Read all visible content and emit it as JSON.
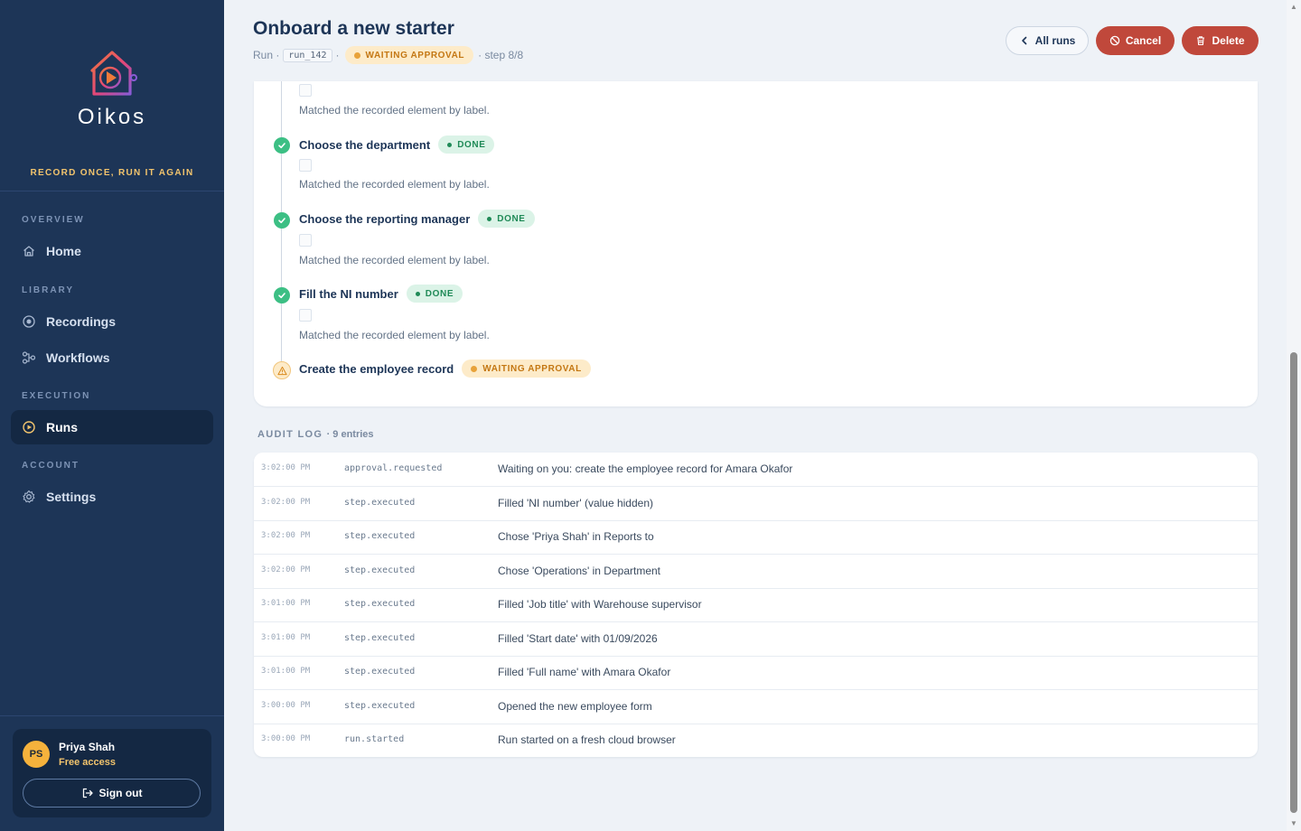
{
  "app": {
    "brand_name": "Oikos",
    "tagline": "RECORD ONCE, RUN IT AGAIN",
    "colors": {
      "sidebar": "#1d3557",
      "accent_gold": "#f2c46d",
      "danger": "#c0483b",
      "success": "#3cbf84",
      "warning": "#e8a23a"
    }
  },
  "sidebar": {
    "sections": [
      {
        "label": "OVERVIEW",
        "items": [
          {
            "label": "Home",
            "icon": "home-icon",
            "active": false
          }
        ]
      },
      {
        "label": "LIBRARY",
        "items": [
          {
            "label": "Recordings",
            "icon": "record-icon",
            "active": false
          },
          {
            "label": "Workflows",
            "icon": "workflow-icon",
            "active": false
          }
        ]
      },
      {
        "label": "EXECUTION",
        "items": [
          {
            "label": "Runs",
            "icon": "play-circle-icon",
            "active": true
          }
        ]
      },
      {
        "label": "ACCOUNT",
        "items": [
          {
            "label": "Settings",
            "icon": "gear-icon",
            "active": false
          }
        ]
      }
    ],
    "user": {
      "initials": "PS",
      "name": "Priya Shah",
      "plan": "Free access",
      "signout_label": "Sign out"
    }
  },
  "header": {
    "title": "Onboard a new starter",
    "run_prefix": "Run ·",
    "run_id": "run_142",
    "separator": "·",
    "status": "WAITING APPROVAL",
    "step_text": "· step 8/8",
    "buttons": {
      "all_runs": "All runs",
      "cancel": "Cancel",
      "delete": "Delete"
    }
  },
  "steps": {
    "top_note": "Matched the recorded element by label.",
    "items": [
      {
        "title": "Choose the department",
        "status": "DONE",
        "note": "Matched the recorded element by label."
      },
      {
        "title": "Choose the reporting manager",
        "status": "DONE",
        "note": "Matched the recorded element by label."
      },
      {
        "title": "Fill the NI number",
        "status": "DONE",
        "note": "Matched the recorded element by label."
      },
      {
        "title": "Create the employee record",
        "status": "WAITING APPROVAL",
        "note": ""
      }
    ]
  },
  "audit": {
    "title": "AUDIT LOG",
    "count": "· 9 entries",
    "rows": [
      {
        "time": "3:02:00 PM",
        "event": "approval.requested",
        "message": "Waiting on you: create the employee record for Amara Okafor"
      },
      {
        "time": "3:02:00 PM",
        "event": "step.executed",
        "message": "Filled 'NI number' (value hidden)"
      },
      {
        "time": "3:02:00 PM",
        "event": "step.executed",
        "message": "Chose 'Priya Shah' in Reports to"
      },
      {
        "time": "3:02:00 PM",
        "event": "step.executed",
        "message": "Chose 'Operations' in Department"
      },
      {
        "time": "3:01:00 PM",
        "event": "step.executed",
        "message": "Filled 'Job title' with Warehouse supervisor"
      },
      {
        "time": "3:01:00 PM",
        "event": "step.executed",
        "message": "Filled 'Start date' with 01/09/2026"
      },
      {
        "time": "3:01:00 PM",
        "event": "step.executed",
        "message": "Filled 'Full name' with Amara Okafor"
      },
      {
        "time": "3:00:00 PM",
        "event": "step.executed",
        "message": "Opened the new employee form"
      },
      {
        "time": "3:00:00 PM",
        "event": "run.started",
        "message": "Run started on a fresh cloud browser"
      }
    ]
  }
}
